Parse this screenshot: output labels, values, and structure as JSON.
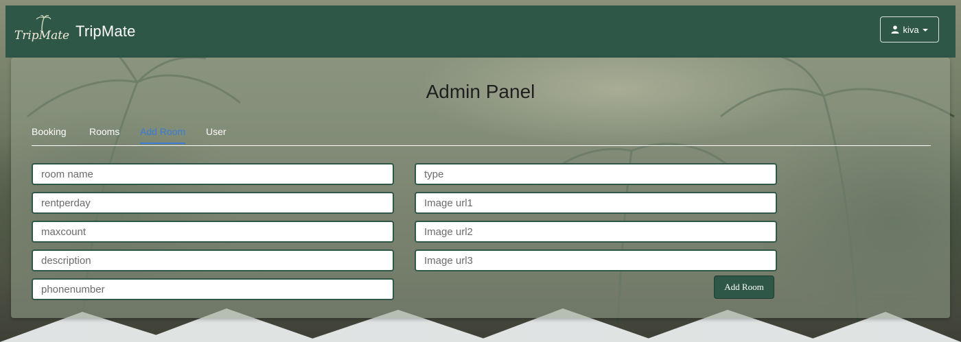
{
  "app": {
    "logo_text": "TripMate",
    "brand": "TripMate"
  },
  "user_menu": {
    "username": "kiva",
    "icon": "user-icon"
  },
  "panel": {
    "title": "Admin Panel",
    "tabs": [
      {
        "label": "Booking",
        "active": false
      },
      {
        "label": "Rooms",
        "active": false
      },
      {
        "label": "Add Room",
        "active": true
      },
      {
        "label": "User",
        "active": false
      }
    ]
  },
  "form": {
    "left_fields": [
      {
        "placeholder": "room name",
        "value": ""
      },
      {
        "placeholder": "rentperday",
        "value": ""
      },
      {
        "placeholder": "maxcount",
        "value": ""
      },
      {
        "placeholder": "description",
        "value": ""
      },
      {
        "placeholder": "phonenumber",
        "value": ""
      }
    ],
    "right_fields": [
      {
        "placeholder": "type",
        "value": ""
      },
      {
        "placeholder": "Image url1",
        "value": ""
      },
      {
        "placeholder": "Image url2",
        "value": ""
      },
      {
        "placeholder": "Image url3",
        "value": ""
      }
    ],
    "submit_label": "Add Room"
  },
  "colors": {
    "primary": "#2e5748",
    "active_tab": "#3a7bd5"
  }
}
